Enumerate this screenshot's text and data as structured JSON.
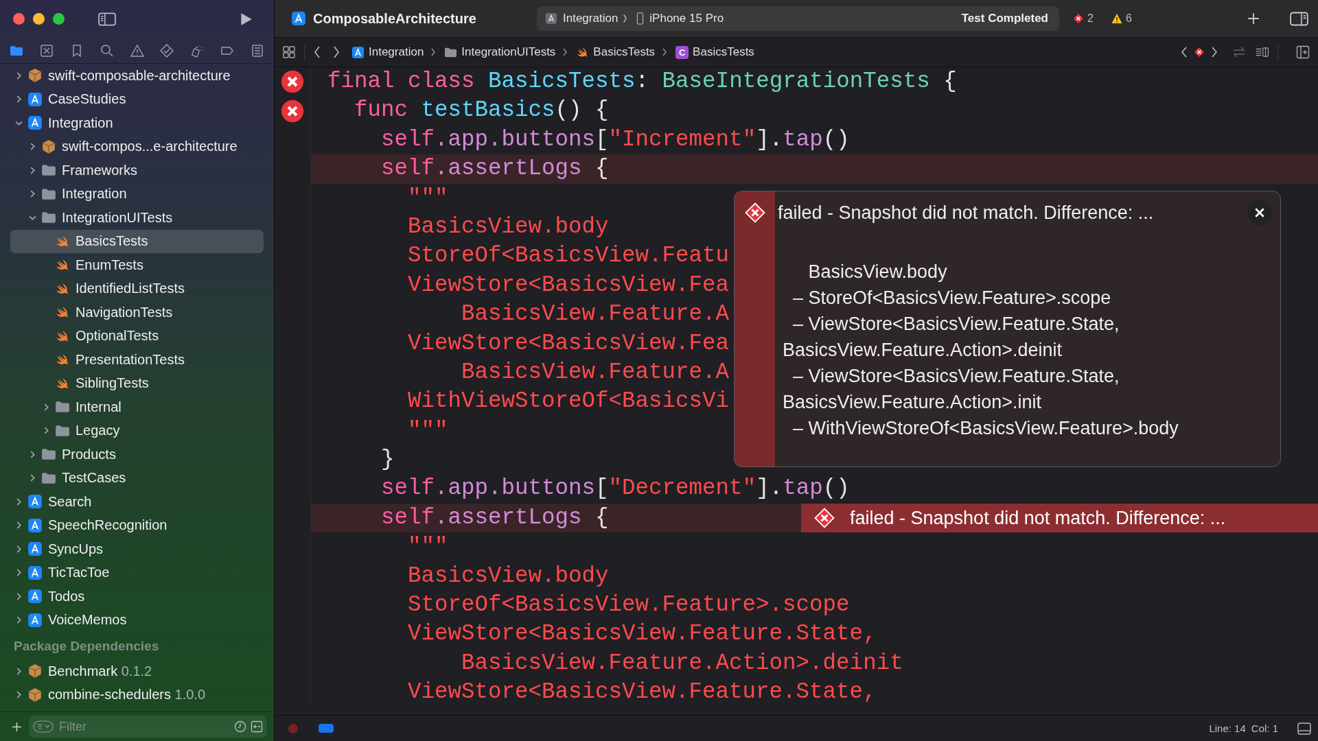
{
  "window": {
    "title": "ComposableArchitecture"
  },
  "toolbar": {
    "scheme": {
      "target": "Integration",
      "device": "iPhone 15 Pro"
    },
    "status": "Test Completed",
    "errors": "2",
    "warnings": "6"
  },
  "navigator_tabs": [
    {
      "selected": true
    },
    {
      "selected": false
    },
    {
      "selected": false
    },
    {
      "selected": false
    },
    {
      "selected": false
    },
    {
      "selected": false
    },
    {
      "selected": false
    },
    {
      "selected": false
    },
    {
      "selected": false
    }
  ],
  "sidebar": {
    "tree": [
      {
        "name": "swift-composable-architecture",
        "kind": "package",
        "expanded": false,
        "selected": false
      },
      {
        "name": "CaseStudies",
        "kind": "app",
        "expanded": false,
        "selected": false
      },
      {
        "name": "Integration",
        "kind": "app",
        "expanded": true,
        "selected": false,
        "children": [
          {
            "name": "swift-compos...e-architecture",
            "kind": "package",
            "expanded": false,
            "selected": false
          },
          {
            "name": "Frameworks",
            "kind": "folder",
            "expanded": false,
            "selected": false
          },
          {
            "name": "Integration",
            "kind": "folder",
            "expanded": false,
            "selected": false
          },
          {
            "name": "IntegrationUITests",
            "kind": "folder",
            "expanded": true,
            "selected": false,
            "children": [
              {
                "name": "BasicsTests",
                "kind": "swift",
                "selected": true
              },
              {
                "name": "EnumTests",
                "kind": "swift",
                "selected": false
              },
              {
                "name": "IdentifiedListTests",
                "kind": "swift",
                "selected": false
              },
              {
                "name": "NavigationTests",
                "kind": "swift",
                "selected": false
              },
              {
                "name": "OptionalTests",
                "kind": "swift",
                "selected": false
              },
              {
                "name": "PresentationTests",
                "kind": "swift",
                "selected": false
              },
              {
                "name": "SiblingTests",
                "kind": "swift",
                "selected": false
              },
              {
                "name": "Internal",
                "kind": "folder",
                "expanded": false,
                "selected": false
              },
              {
                "name": "Legacy",
                "kind": "folder",
                "expanded": false,
                "selected": false
              }
            ]
          },
          {
            "name": "Products",
            "kind": "folder",
            "expanded": false,
            "selected": false
          },
          {
            "name": "TestCases",
            "kind": "folder",
            "expanded": false,
            "selected": false
          }
        ]
      },
      {
        "name": "Search",
        "kind": "app",
        "expanded": false,
        "selected": false
      },
      {
        "name": "SpeechRecognition",
        "kind": "app",
        "expanded": false,
        "selected": false
      },
      {
        "name": "SyncUps",
        "kind": "app",
        "expanded": false,
        "selected": false
      },
      {
        "name": "TicTacToe",
        "kind": "app",
        "expanded": false,
        "selected": false
      },
      {
        "name": "Todos",
        "kind": "app",
        "expanded": false,
        "selected": false
      },
      {
        "name": "VoiceMemos",
        "kind": "app",
        "expanded": false,
        "selected": false
      }
    ],
    "package_dependencies": {
      "title": "Package Dependencies",
      "items": [
        {
          "name": "Benchmark",
          "version": "0.1.2",
          "kind": "package",
          "expanded": false,
          "selected": false
        },
        {
          "name": "combine-schedulers",
          "version": "1.0.0",
          "kind": "package",
          "expanded": false,
          "selected": false
        }
      ]
    },
    "filter": {
      "placeholder": "Filter"
    }
  },
  "jump_bar": [
    {
      "text": "Integration",
      "kind": "app"
    },
    {
      "text": "IntegrationUITests",
      "kind": "folder"
    },
    {
      "text": "BasicsTests",
      "kind": "swift"
    },
    {
      "text": "BasicsTests",
      "kind": "class",
      "badge": "C"
    }
  ],
  "editor": {
    "lines": [
      {
        "marker": true,
        "highlighted": false,
        "tokens": [
          {
            "t": "final class ",
            "kind": "keyword"
          },
          {
            "t": "BasicsTests",
            "kind": "type_decl"
          },
          {
            "t": ": ",
            "kind": "plain"
          },
          {
            "t": "BaseIntegrationTests",
            "kind": "type_ref"
          },
          {
            "t": " {",
            "kind": "plain"
          }
        ]
      },
      {
        "marker": true,
        "highlighted": false,
        "tokens": [
          {
            "t": "  func ",
            "kind": "keyword"
          },
          {
            "t": "testBasics",
            "kind": "type_decl"
          },
          {
            "t": "() {",
            "kind": "plain"
          }
        ]
      },
      {
        "highlighted": false,
        "tokens": [
          {
            "t": "    self",
            "kind": "keyword"
          },
          {
            "t": ".app.buttons",
            "kind": "member"
          },
          {
            "t": "[",
            "kind": "plain"
          },
          {
            "t": "\"Increment\"",
            "kind": "string"
          },
          {
            "t": "].",
            "kind": "plain"
          },
          {
            "t": "tap",
            "kind": "member"
          },
          {
            "t": "()",
            "kind": "plain"
          }
        ]
      },
      {
        "highlighted": true,
        "tokens": [
          {
            "t": "    self",
            "kind": "keyword"
          },
          {
            "t": ".assertLogs",
            "kind": "member"
          },
          {
            "t": " {",
            "kind": "plain"
          }
        ]
      },
      {
        "highlighted": false,
        "tokens": [
          {
            "t": "      \"\"\"",
            "kind": "string"
          }
        ]
      },
      {
        "highlighted": false,
        "tokens": [
          {
            "t": "      BasicsView.body",
            "kind": "string"
          }
        ]
      },
      {
        "highlighted": false,
        "tokens": [
          {
            "t": "      StoreOf<BasicsView.Featu",
            "kind": "string"
          }
        ]
      },
      {
        "highlighted": false,
        "tokens": [
          {
            "t": "      ViewStore<BasicsView.Fea",
            "kind": "string"
          }
        ]
      },
      {
        "highlighted": false,
        "tokens": [
          {
            "t": "          BasicsView.Feature.A",
            "kind": "string"
          }
        ]
      },
      {
        "highlighted": false,
        "tokens": [
          {
            "t": "      ViewStore<BasicsView.Fea",
            "kind": "string"
          }
        ]
      },
      {
        "highlighted": false,
        "tokens": [
          {
            "t": "          BasicsView.Feature.A",
            "kind": "string"
          }
        ]
      },
      {
        "highlighted": false,
        "tokens": [
          {
            "t": "      WithViewStoreOf<BasicsVi",
            "kind": "string"
          }
        ]
      },
      {
        "highlighted": false,
        "tokens": [
          {
            "t": "      \"\"\"",
            "kind": "string"
          }
        ]
      },
      {
        "highlighted": false,
        "tokens": [
          {
            "t": "    }",
            "kind": "plain"
          }
        ]
      },
      {
        "highlighted": false,
        "tokens": [
          {
            "t": "    self",
            "kind": "keyword"
          },
          {
            "t": ".app.buttons",
            "kind": "member"
          },
          {
            "t": "[",
            "kind": "plain"
          },
          {
            "t": "\"Decrement\"",
            "kind": "string"
          },
          {
            "t": "].",
            "kind": "plain"
          },
          {
            "t": "tap",
            "kind": "member"
          },
          {
            "t": "()",
            "kind": "plain"
          }
        ]
      },
      {
        "highlighted": true,
        "tokens": [
          {
            "t": "    self",
            "kind": "keyword"
          },
          {
            "t": ".assertLogs",
            "kind": "member"
          },
          {
            "t": " {",
            "kind": "plain"
          }
        ],
        "annotation": "failed - Snapshot did not match. Difference: ..."
      },
      {
        "highlighted": false,
        "tokens": [
          {
            "t": "      \"\"\"",
            "kind": "string"
          }
        ]
      },
      {
        "highlighted": false,
        "tokens": [
          {
            "t": "      BasicsView.body",
            "kind": "string"
          }
        ]
      },
      {
        "highlighted": false,
        "tokens": [
          {
            "t": "      StoreOf<BasicsView.Feature>.scope",
            "kind": "string"
          }
        ]
      },
      {
        "highlighted": false,
        "tokens": [
          {
            "t": "      ViewStore<BasicsView.Feature.State,",
            "kind": "string"
          }
        ]
      },
      {
        "highlighted": false,
        "tokens": [
          {
            "t": "          BasicsView.Feature.Action>.deinit",
            "kind": "string"
          }
        ]
      },
      {
        "highlighted": false,
        "tokens": [
          {
            "t": "      ViewStore<BasicsView.Feature.State,",
            "kind": "string"
          }
        ]
      }
    ],
    "popover": {
      "title": "failed - Snapshot did not match. Difference: ...",
      "message": [
        "     BasicsView.body",
        "  – StoreOf<BasicsView.Feature>.scope",
        "  – ViewStore<BasicsView.Feature.State,",
        "BasicsView.Feature.Action>.deinit",
        "  – ViewStore<BasicsView.Feature.State,",
        "BasicsView.Feature.Action>.init",
        "  – WithViewStoreOf<BasicsView.Feature>.body"
      ]
    }
  },
  "status_bar": {
    "line": "Line: 14",
    "column": "Col: 1"
  }
}
